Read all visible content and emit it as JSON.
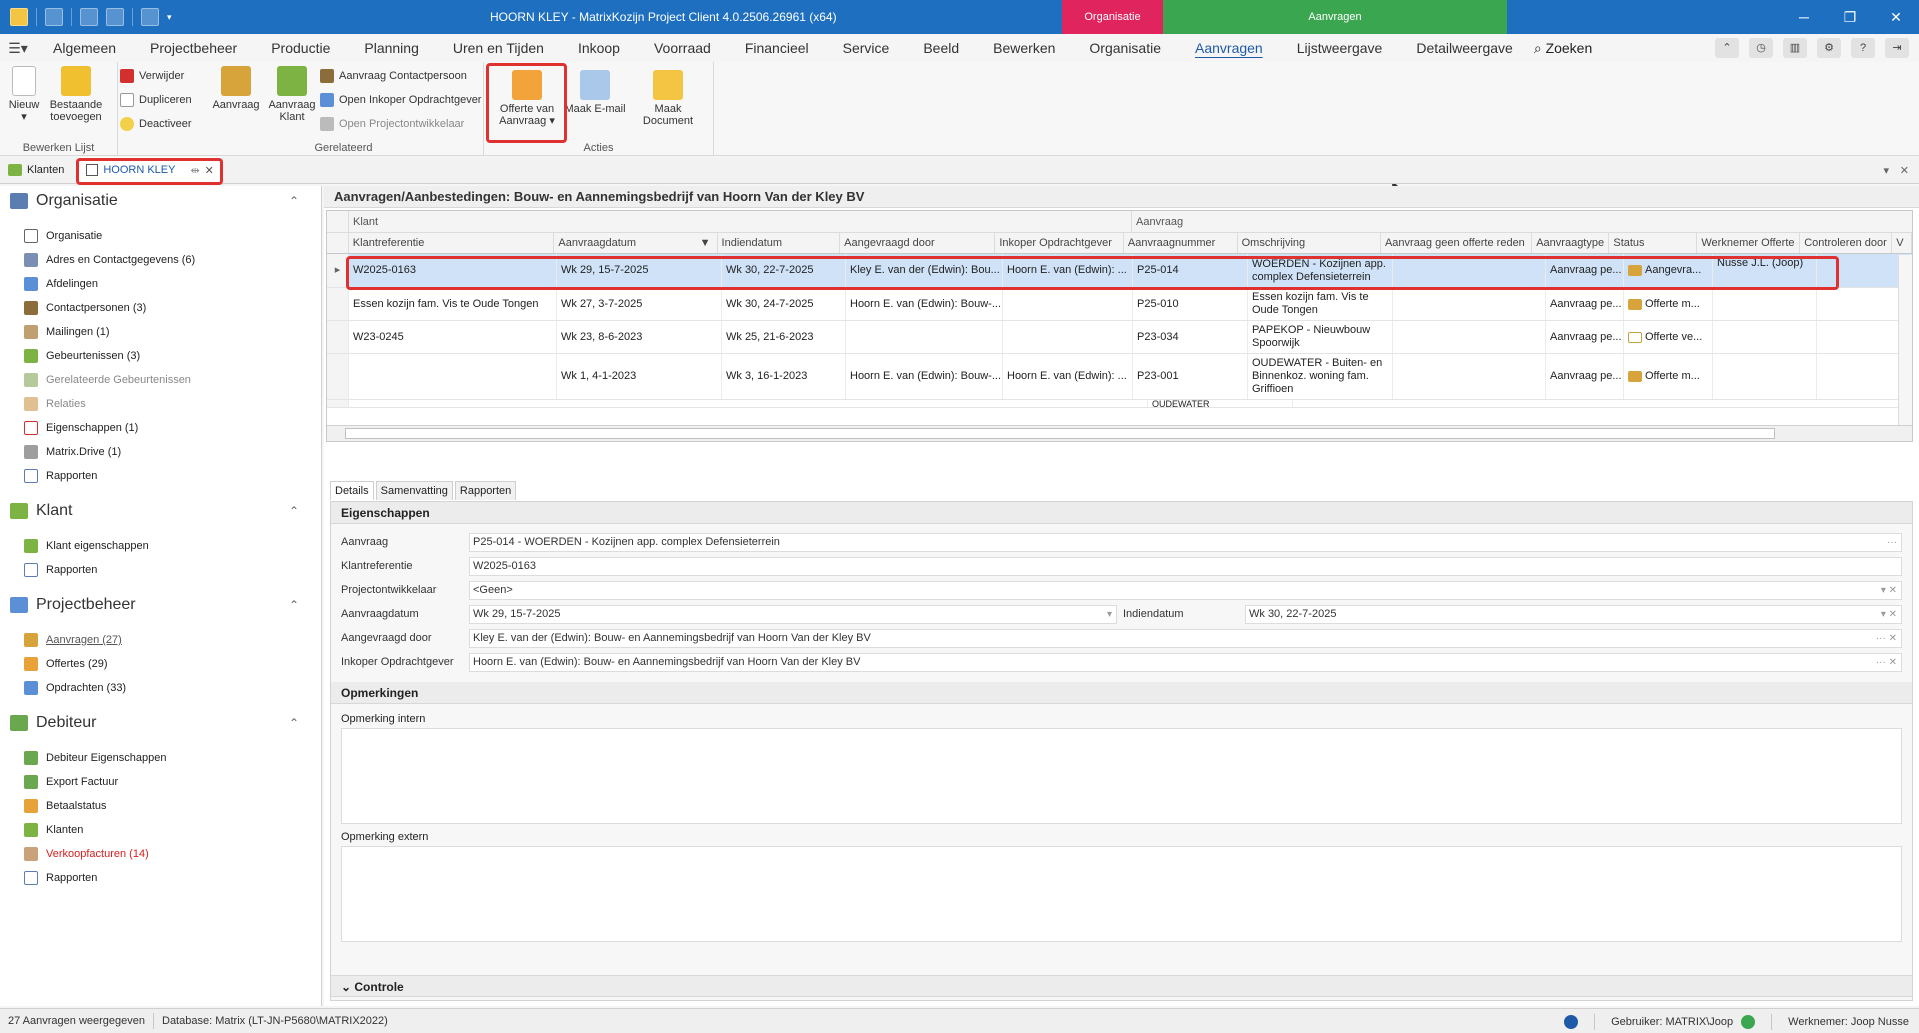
{
  "window": {
    "title": "HOORN KLEY - MatrixKozijn Project Client 4.0.2506.26961 (x64)",
    "context_org": "Organisatie",
    "context_aanvragen": "Aanvragen",
    "minimize": "─",
    "maximize": "❐",
    "close": "✕"
  },
  "menu": {
    "tabs": [
      "Algemeen",
      "Projectbeheer",
      "Productie",
      "Planning",
      "Uren en Tijden",
      "Inkoop",
      "Voorraad",
      "Financieel",
      "Service",
      "Beeld",
      "Bewerken",
      "Organisatie",
      "Aanvragen",
      "Lijstweergave",
      "Detailweergave"
    ],
    "active_tab": "Aanvragen",
    "search": "Zoeken"
  },
  "ribbon": {
    "nieuw": "Nieuw",
    "bestaande_toevoegen_1": "Bestaande",
    "bestaande_toevoegen_2": "toevoegen",
    "verwijder": "Verwijder",
    "dupliceren": "Dupliceren",
    "deactiveer": "Deactiveer",
    "group_bewerken": "Bewerken Lijst",
    "aanvraag": "Aanvraag",
    "aanvraag_klant_1": "Aanvraag",
    "aanvraag_klant_2": "Klant",
    "aanvraag_contactpersoon": "Aanvraag Contactpersoon",
    "open_inkoper": "Open Inkoper Opdrachtgever",
    "open_projectontwikkelaar": "Open Projectontwikkelaar",
    "group_gerelateerd": "Gerelateerd",
    "offerte_1": "Offerte van",
    "offerte_2": "Aanvraag",
    "maak_email": "Maak E-mail",
    "maak_document": "Maak Document",
    "group_acties": "Acties"
  },
  "doctabs": {
    "klanten": "Klanten",
    "hoorn_kley": "HOORN KLEY"
  },
  "leftnav": {
    "organisatie": {
      "title": "Organisatie",
      "items": [
        "Organisatie",
        "Adres en Contactgegevens (6)",
        "Afdelingen",
        "Contactpersonen (3)",
        "Mailingen (1)",
        "Gebeurtenissen (3)",
        "Gerelateerde Gebeurtenissen",
        "Relaties",
        "Eigenschappen (1)",
        "Matrix.Drive (1)",
        "Rapporten"
      ]
    },
    "klant": {
      "title": "Klant",
      "items": [
        "Klant eigenschappen",
        "Rapporten"
      ]
    },
    "projectbeheer": {
      "title": "Projectbeheer",
      "items": [
        "Aanvragen (27)",
        "Offertes (29)",
        "Opdrachten (33)"
      ]
    },
    "debiteur": {
      "title": "Debiteur",
      "items": [
        "Debiteur Eigenschappen",
        "Export Factuur",
        "Betaalstatus",
        "Klanten",
        "Verkoopfacturen (14)",
        "Rapporten"
      ]
    }
  },
  "grid": {
    "title": "Aanvragen/Aanbestedingen: Bouw- en Aannemingsbedrijf van Hoorn Van der Kley BV",
    "band_klant": "Klant",
    "band_aanvraag": "Aanvraag",
    "columns": [
      "Klantreferentie",
      "Aanvraagdatum",
      "Indiendatum",
      "Aangevraagd door",
      "Inkoper Opdrachtgever",
      "Aanvraagnummer",
      "Omschrijving",
      "Aanvraag geen offerte reden",
      "Aanvraagtype",
      "Status",
      "Werknemer Offerte",
      "Controleren door",
      "V"
    ],
    "rows": [
      {
        "ref": "W2025-0163",
        "datum": "Wk 29, 15-7-2025",
        "indien": "Wk 30, 22-7-2025",
        "door": "Kley E. van der (Edwin): Bou...",
        "inkoper": "Hoorn E. van (Edwin): ...",
        "nummer": "P25-014",
        "oms": "WOERDEN - Kozijnen app. complex Defensieterrein",
        "reden": "",
        "type": "Aanvraag pe...",
        "status": "Aangevra...",
        "werknemer": "Nusse J.L. (Joop)",
        "contr": ""
      },
      {
        "ref": "Essen kozijn fam. Vis te Oude Tongen",
        "datum": "Wk 27, 3-7-2025",
        "indien": "Wk 30, 24-7-2025",
        "door": "Hoorn E. van (Edwin): Bouw-...",
        "inkoper": "",
        "nummer": "P25-010",
        "oms": "Essen kozijn fam. Vis te Oude Tongen",
        "reden": "",
        "type": "Aanvraag pe...",
        "status": "Offerte m...",
        "werknemer": "",
        "contr": ""
      },
      {
        "ref": "W23-0245",
        "datum": "Wk 23, 8-6-2023",
        "indien": "Wk 25, 21-6-2023",
        "door": "",
        "inkoper": "",
        "nummer": "P23-034",
        "oms": "PAPEKOP - Nieuwbouw Spoorwijk",
        "reden": "",
        "type": "Aanvraag pe...",
        "status": "Offerte ve...",
        "werknemer": "",
        "contr": ""
      },
      {
        "ref": "",
        "datum": "Wk 1, 4-1-2023",
        "indien": "Wk 3, 16-1-2023",
        "door": "Hoorn E. van (Edwin): Bouw-...",
        "inkoper": "Hoorn E. van (Edwin): ...",
        "nummer": "P23-001",
        "oms": "OUDEWATER - Buiten- en Binnenkoz. woning fam. Griffioen",
        "reden": "",
        "type": "Aanvraag pe...",
        "status": "Offerte m...",
        "werknemer": "",
        "contr": ""
      }
    ],
    "partial_row": "OUDEWATER"
  },
  "details": {
    "tabs": [
      "Details",
      "Samenvatting",
      "Rapporten"
    ],
    "eigenschappen": "Eigenschappen",
    "fields": {
      "aanvraag_label": "Aanvraag",
      "aanvraag_value": "P25-014 - WOERDEN - Kozijnen app. complex Defensieterrein",
      "klantref_label": "Klantreferentie",
      "klantref_value": "W2025-0163",
      "projectontw_label": "Projectontwikkelaar",
      "projectontw_value": "<Geen>",
      "aanvraagdatum_label": "Aanvraagdatum",
      "aanvraagdatum_value": "Wk 29, 15-7-2025",
      "indiendatum_label": "Indiendatum",
      "indiendatum_value": "Wk 30, 22-7-2025",
      "aangevraagd_label": "Aangevraagd door",
      "aangevraagd_value": "Kley E. van der (Edwin): Bouw- en Aannemingsbedrijf van Hoorn Van der Kley BV",
      "inkoper_label": "Inkoper Opdrachtgever",
      "inkoper_value": "Hoorn E. van (Edwin): Bouw- en Aannemingsbedrijf van Hoorn Van der Kley BV"
    },
    "opmerkingen": "Opmerkingen",
    "opmerking_intern": "Opmerking intern",
    "opmerking_extern": "Opmerking extern",
    "controle": "Controle"
  },
  "status": {
    "count": "27 Aanvragen weergegeven",
    "database": "Database: Matrix (LT-JN-P5680\\MATRIX2022)",
    "gebruiker": "Gebruiker: MATRIX\\Joop",
    "werknemer": "Werknemer: Joop Nusse"
  },
  "colors": {
    "titlebar": "#1e6fc0",
    "context_org": "#e0245e",
    "context_aanvragen": "#3aa650",
    "highlight": "#e03131",
    "selected_row": "#cfe2f7"
  }
}
